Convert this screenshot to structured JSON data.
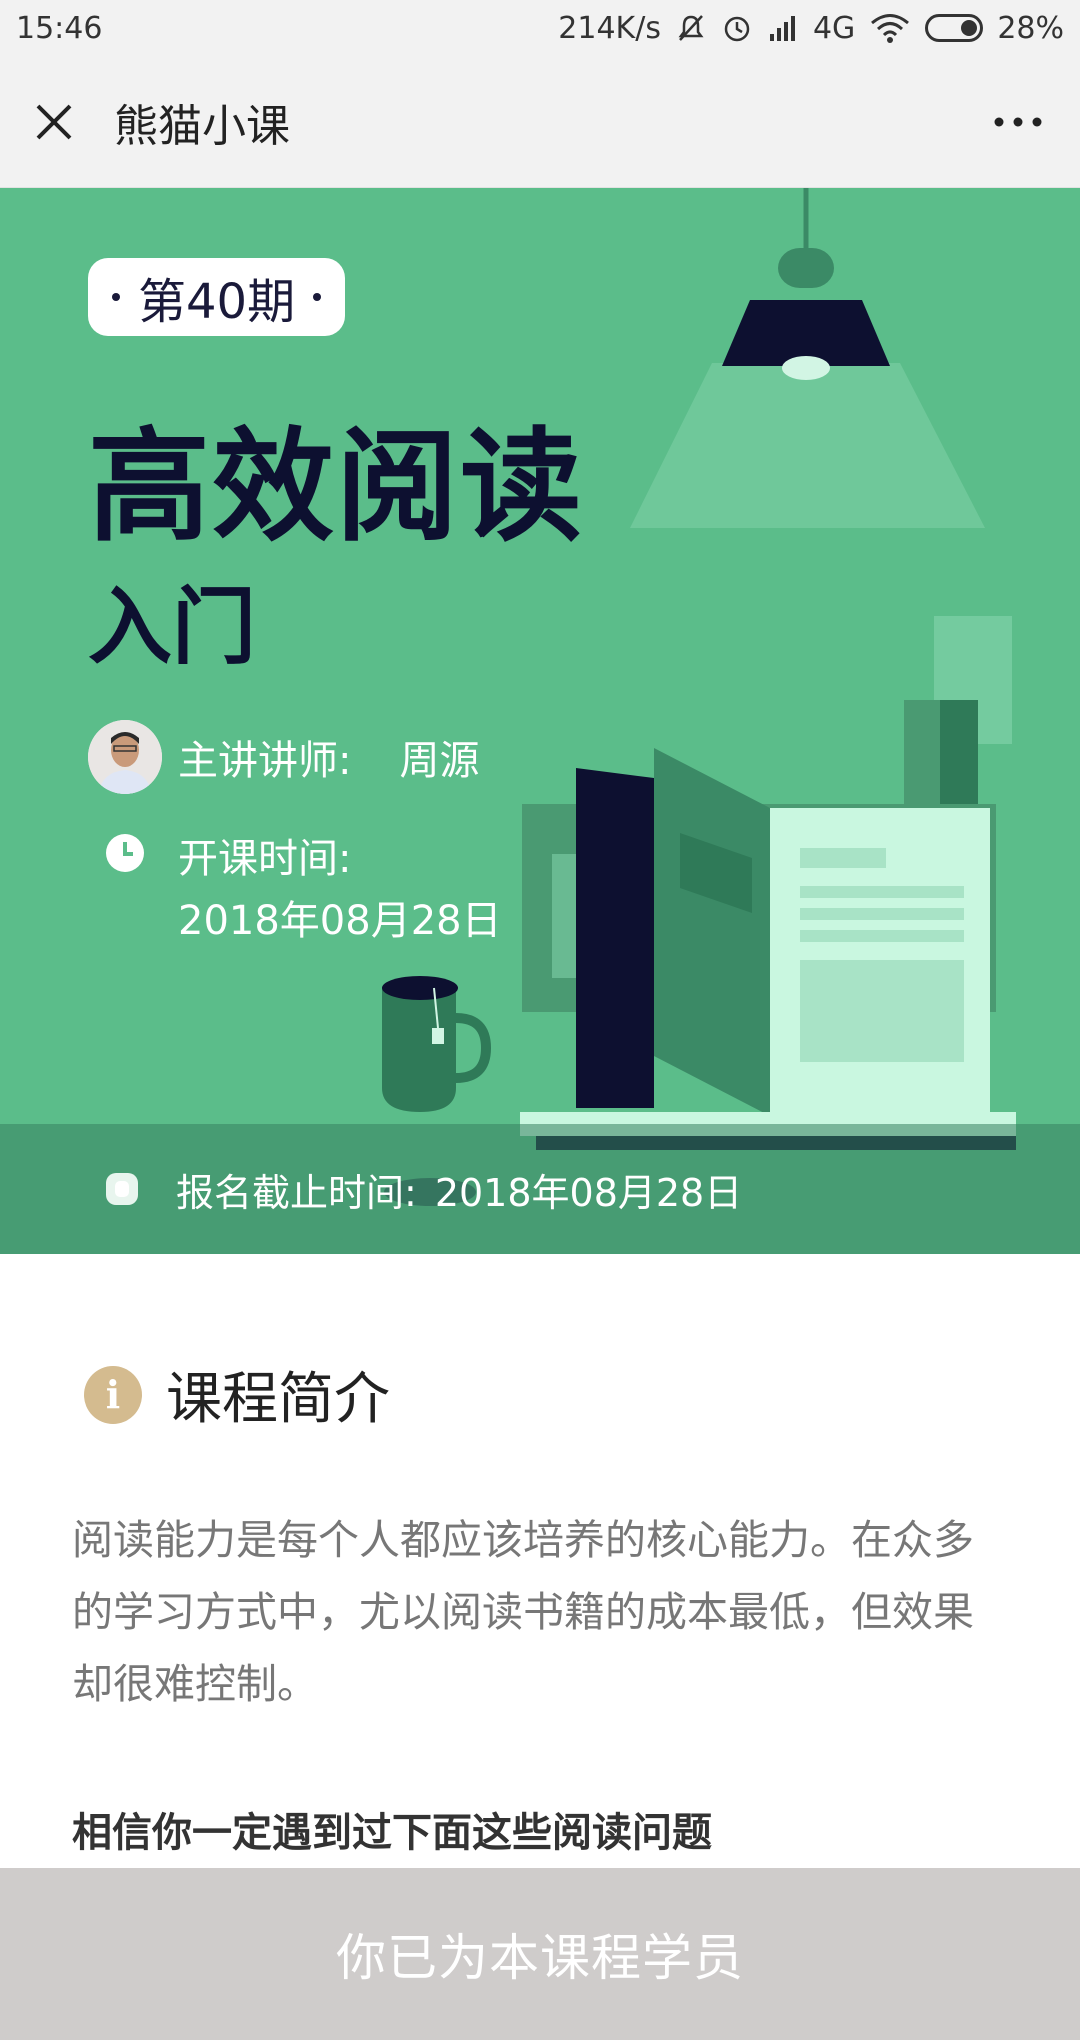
{
  "status_bar": {
    "time": "15:46",
    "network_speed": "214K/s",
    "network_type": "4G",
    "battery": "28%",
    "icons": [
      "mute-icon",
      "alarm-icon",
      "signal-icon",
      "wifi-icon",
      "battery-icon"
    ]
  },
  "nav": {
    "title": "熊猫小课",
    "close_icon": "close-icon",
    "more_icon": "more-icon"
  },
  "hero": {
    "issue_badge": "第40期",
    "title": "高效阅读",
    "subtitle": "入门",
    "teacher_label": "主讲讲师:",
    "teacher_name": "周源",
    "start_label": "开课时间:",
    "start_date": "2018年08月28日",
    "deadline_label": "报名截止时间:",
    "deadline_date": "2018年08月28日",
    "colors": {
      "background": "#5bbd8a",
      "title": "#0d1030"
    }
  },
  "intro": {
    "section_title": "课程简介",
    "paragraph": "阅读能力是每个人都应该培养的核心能力。在众多的学习方式中，尤以阅读书籍的成本最低，但效果却很难控制。",
    "sub_heading": "相信你一定遇到过下面这些阅读问题"
  },
  "bottom_bar": {
    "label": "你已为本课程学员"
  }
}
